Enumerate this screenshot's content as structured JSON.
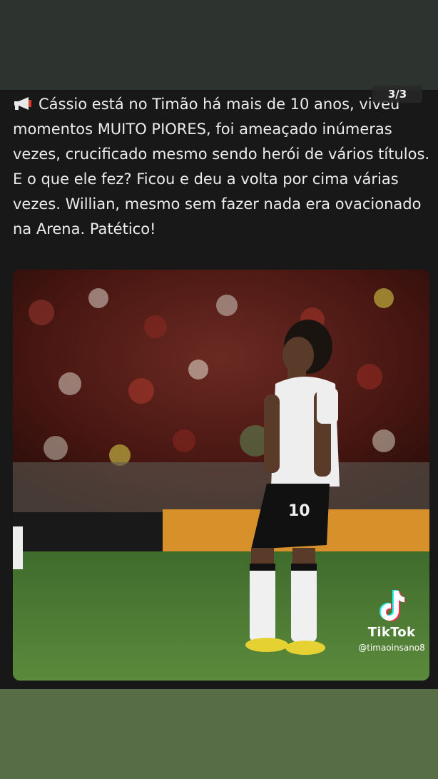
{
  "post": {
    "counter": "3/3",
    "text_line1": "Cássio está no Timão há mais de 10 anos, viveu momentos MUITO PIORES, foi ameaçado inúmeras vezes, crucificado mesmo sendo herói de vários títulos.",
    "text_line2": "E o que ele fez? Ficou e deu a volta por cima várias vezes. Willian, mesmo sem fazer nada era ovacionado na Arena. Patético!"
  },
  "photo": {
    "shirt_number": "10"
  },
  "watermark": {
    "brand": "TikTok",
    "handle": "@timaoinsano8"
  },
  "icons": {
    "megaphone": "megaphone-icon",
    "tiktok": "tiktok-logo-icon"
  },
  "colors": {
    "top_bar": "#2d332f",
    "card": "#181818",
    "bottom_bar": "#566d46",
    "text": "#ececec"
  }
}
